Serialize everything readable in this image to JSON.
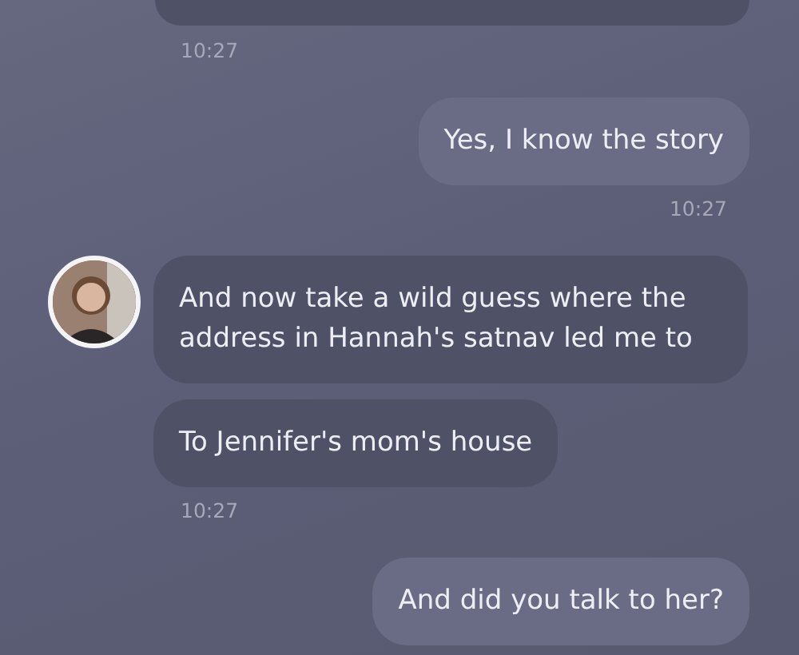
{
  "cut_off_bubble": {
    "kind": "incoming"
  },
  "groups": [
    {
      "kind": "incoming",
      "time": "10:27"
    },
    {
      "kind": "outgoing",
      "bubbles": [
        "Yes, I know the story"
      ],
      "time": "10:27"
    },
    {
      "kind": "incoming",
      "avatar": true,
      "bubbles": [
        "And now take a wild guess where the address in Hannah's satnav led me to",
        "To Jennifer's mom's house"
      ],
      "time": "10:27"
    },
    {
      "kind": "outgoing",
      "bubbles": [
        "And did you talk to her?"
      ]
    }
  ]
}
